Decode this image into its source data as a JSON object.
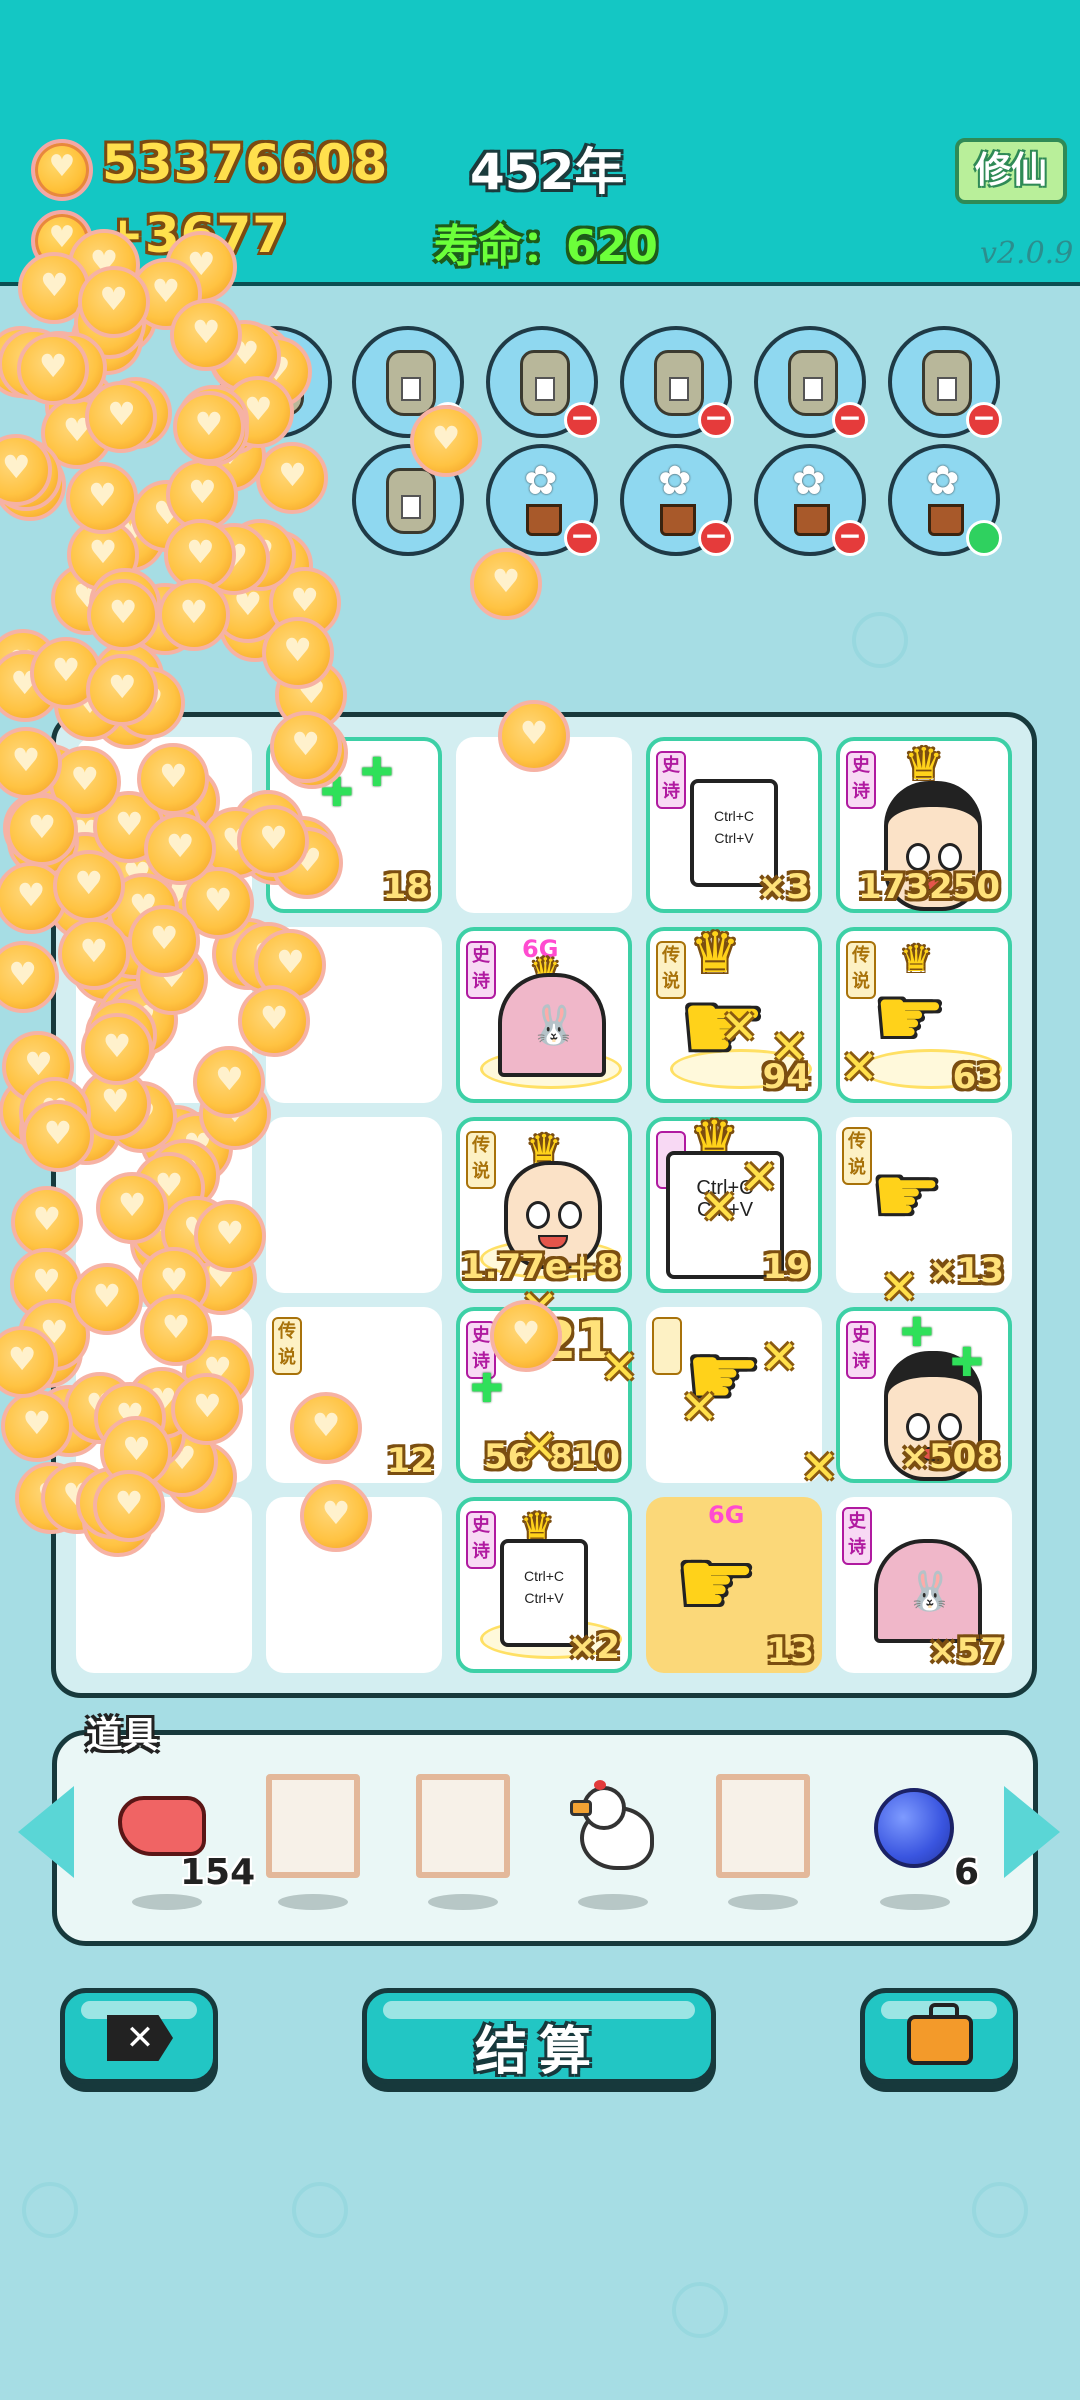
{
  "header": {
    "coins": "53376608",
    "income": "+3677",
    "year": "452年",
    "lifespan": "寿命：620",
    "cultivate_button": "修仙",
    "version": "v2.0.9"
  },
  "board": {
    "cells": [
      {
        "count": "18"
      },
      {
        "tag": "史诗",
        "count": "×3"
      },
      {
        "tag": "史诗",
        "count": "173250"
      },
      {
        "tag": "史诗",
        "grade": "6G"
      },
      {
        "tag": "传说",
        "count": "94"
      },
      {
        "tag": "传说",
        "count": "63"
      },
      {
        "tag": "传说",
        "count": "1.77e+8"
      },
      {
        "tag": "史诗",
        "count": "19"
      },
      {
        "tag": "传说",
        "count": "×13"
      },
      {
        "tag": "传说",
        "count": "12"
      },
      {
        "tag": "史诗",
        "count": "56",
        "count2": "810",
        "floating": "21"
      },
      {
        "tag": "史诗",
        "count": "×508"
      },
      {
        "tag": "史诗",
        "count": "×2"
      },
      {
        "grade": "6G",
        "count": "13"
      },
      {
        "tag": "史诗",
        "count": "×57"
      }
    ],
    "copy_text": [
      "Ctrl+C",
      "Ctrl+V"
    ]
  },
  "items": {
    "label": "道具",
    "counts": {
      "liver": "154",
      "blueberry": "6"
    }
  },
  "buttons": {
    "settle": "结算"
  }
}
